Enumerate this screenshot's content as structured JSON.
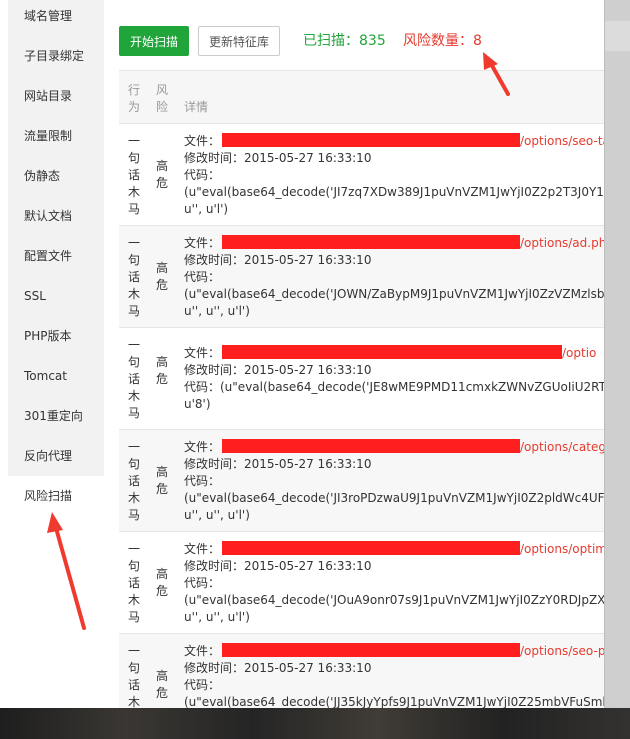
{
  "sidebar": {
    "items": [
      {
        "label": "域名管理"
      },
      {
        "label": "子目录绑定"
      },
      {
        "label": "网站目录"
      },
      {
        "label": "流量限制"
      },
      {
        "label": "伪静态"
      },
      {
        "label": "默认文档"
      },
      {
        "label": "配置文件"
      },
      {
        "label": "SSL"
      },
      {
        "label": "PHP版本"
      },
      {
        "label": "Tomcat"
      },
      {
        "label": "301重定向"
      },
      {
        "label": "反向代理"
      },
      {
        "label": "风险扫描"
      }
    ],
    "active": "风险扫描"
  },
  "toolbar": {
    "scan_button": "开始扫描",
    "update_button": "更新特征库",
    "scanned_text": "已扫描：835",
    "risk_text": "风险数量：8"
  },
  "table": {
    "headers": {
      "action": [
        "行",
        "为"
      ],
      "level": [
        "风",
        "险"
      ],
      "detail": "详情"
    },
    "rows": [
      {
        "action": [
          "一",
          "句",
          "话",
          "木",
          "马"
        ],
        "level": [
          "高",
          "危"
        ],
        "file_label": "文件：",
        "path_tail": "/options/seo-ta",
        "mtime": "修改时间：2015-05-27 16:33:10",
        "code_lines": [
          "代码：",
          "(u\"eval(base64_decode('JI7zq7XDw389J1puVnVZM1JwYjI0Z2p2T3J0Y1BE",
          "u'', u'l')"
        ]
      },
      {
        "action": [
          "一",
          "句",
          "话",
          "木",
          "马"
        ],
        "level": [
          "高",
          "危"
        ],
        "file_label": "文件：",
        "path_tail": "/options/ad.php",
        "mtime": "修改时间：2015-05-27 16:33:10",
        "code_lines": [
          "代码：",
          "(u\"eval(base64_decode('JOWN/ZaBypM9J1puVnVZM1JwYjI0ZzVZMzlsb0l",
          "u'', u'', u'l')"
        ]
      },
      {
        "action": [
          "一",
          "句",
          "话",
          "木",
          "马"
        ],
        "level": [
          "高",
          "危"
        ],
        "file_label": "文件：",
        "path_tail": "/optio",
        "mtime": "修改时间：2015-05-27 16:33:10",
        "code_lines": [
          "代码：(u\"eval(base64_decode('JE8wME9PMD11cmxkZWNvZGUoIiU2RTElN",
          "u'8')"
        ]
      },
      {
        "action": [
          "一",
          "句",
          "话",
          "木",
          "马"
        ],
        "level": [
          "高",
          "危"
        ],
        "file_label": "文件：",
        "path_tail": "/options/catego",
        "mtime": "修改时间：2015-05-27 16:33:10",
        "code_lines": [
          "代码：",
          "(u\"eval(base64_decode('JI3roPDzwaU9J1puVnVZM1JwYjI0Z2pldWc4UFBG",
          "u'', u'', u'l')"
        ]
      },
      {
        "action": [
          "一",
          "句",
          "话",
          "木",
          "马"
        ],
        "level": [
          "高",
          "危"
        ],
        "file_label": "文件：",
        "path_tail": "/options/optim",
        "mtime": "修改时间：2015-05-27 16:33:10",
        "code_lines": [
          "代码：",
          "(u\"eval(base64_decode('JOuA9onr07s9J1puVnVZM1JwYjI0ZzY0RDJpZXZU",
          "u'', u'', u'l')"
        ]
      },
      {
        "action": [
          "一",
          "句",
          "话",
          "木",
          "马"
        ],
        "level": [
          "高",
          "危"
        ],
        "file_label": "文件：",
        "path_tail": "/options/seo-pa",
        "mtime": "修改时间：2015-05-27 16:33:10",
        "code_lines": [
          "代码：",
          "(u\"eval(base64_decode('JJ35kJyYpfs9J1puVnVZM1JwYjI0Z25mbVFuSmlsK"
        ]
      }
    ]
  },
  "colors": {
    "brand_green": "#20a53a",
    "risk_red": "#e53a2f",
    "redaction": "#ff1f1f",
    "annotation_arrow": "#f03a2e"
  }
}
